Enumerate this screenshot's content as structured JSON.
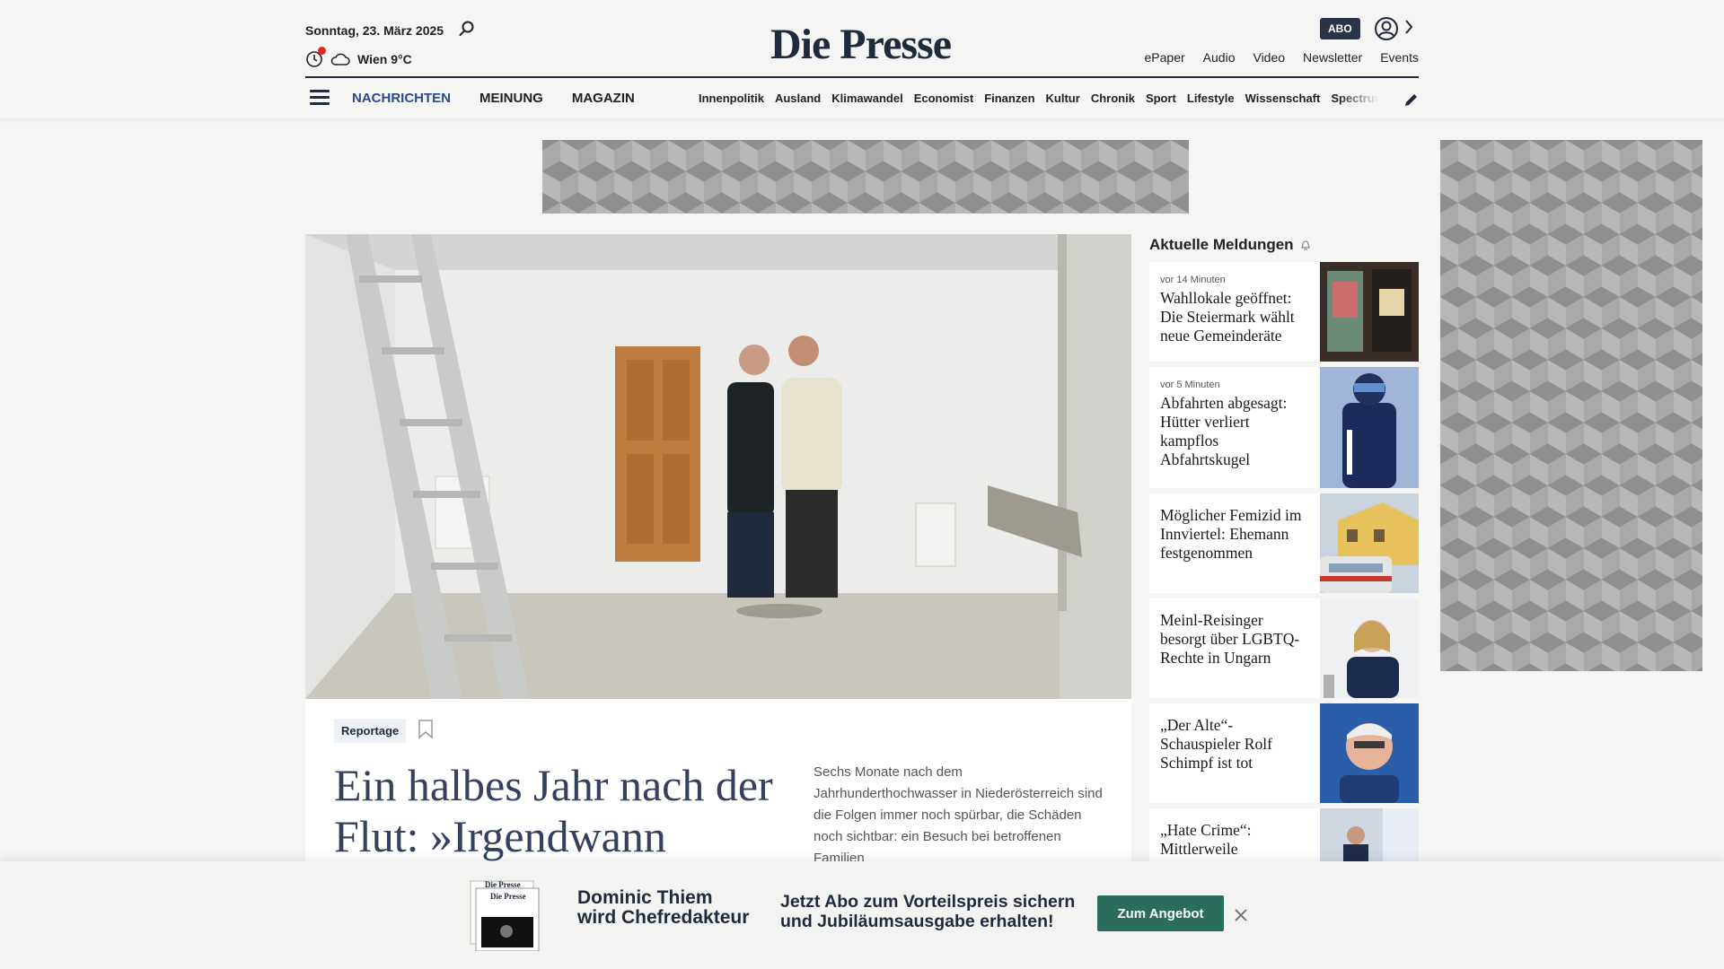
{
  "header": {
    "date": "Sonntag, 23. März 2025",
    "weather": "Wien 9°C",
    "logo": "Die Presse",
    "abo_badge": "ABO",
    "top_links": [
      "ePaper",
      "Audio",
      "Video",
      "Newsletter",
      "Events"
    ],
    "main_nav": [
      "NACHRICHTEN",
      "MEINUNG",
      "MAGAZIN"
    ],
    "sub_nav": [
      "Innenpolitik",
      "Ausland",
      "Klimawandel",
      "Economist",
      "Finanzen",
      "Kultur",
      "Chronik",
      "Sport",
      "Lifestyle",
      "Wissenschaft",
      "Spectrum"
    ]
  },
  "hero": {
    "kicker": "Reportage",
    "headline": "Ein halbes Jahr nach der Flut: »Irgendwann",
    "teaser": "Sechs Monate nach dem Jahrhunderthochwasser in Niederösterreich sind die Folgen immer noch spürbar, die Schäden noch sichtbar: ein Besuch bei betroffenen Familien"
  },
  "news": {
    "title": "Aktuelle Meldungen",
    "items": [
      {
        "time": "vor 14 Minuten",
        "headline": "Wahllokale geöffnet: Die Steiermark wählt neue Gemeinderäte"
      },
      {
        "time": "vor 5 Minuten",
        "headline": "Abfahrten abgesagt: Hütter verliert kampflos Abfahrtskugel"
      },
      {
        "time": "",
        "headline": "Möglicher Femizid im Innviertel: Ehemann festgenommen"
      },
      {
        "time": "",
        "headline": "Meinl-Reisinger besorgt über LGBTQ-Rechte in Ungarn"
      },
      {
        "time": "",
        "headline": "„Der Alte“-Schauspieler Rolf Schimpf ist tot"
      },
      {
        "time": "",
        "headline": "„Hate Crime“: Mittlerweile"
      }
    ]
  },
  "banner": {
    "name_line1": "Dominic Thiem",
    "name_line2": "wird Chefredakteur",
    "cta_line1": "Jetzt Abo zum Vorteilspreis sichern",
    "cta_line2": "und Jubiläumsausgabe erhalten!",
    "button": "Zum Angebot",
    "paper_logo": "Die Presse"
  },
  "colors": {
    "navy": "#1f2a3d",
    "active_nav": "#2a4a8b",
    "cta_green": "#2a6d5c",
    "alert_red": "#e0262f"
  }
}
